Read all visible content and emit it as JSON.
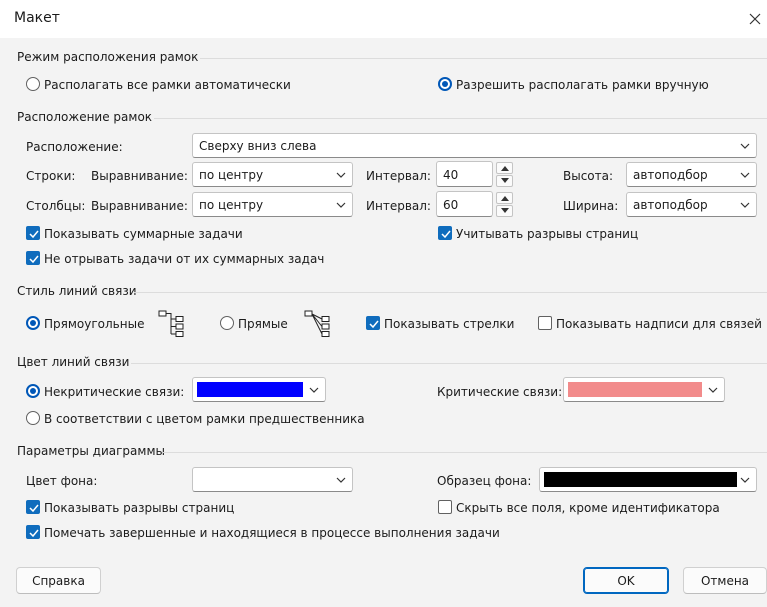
{
  "window": {
    "title": "Макет"
  },
  "colors": {
    "accent": "#0057b7",
    "noncritical": "#0000ff",
    "critical": "#f28b8b",
    "sample": "#000000",
    "background": "#ffffff"
  },
  "frame_mode": {
    "title": "Режим расположения рамок",
    "auto_label": "Располагать все рамки автоматически",
    "manual_label": "Разрешить располагать рамки вручную",
    "selected": "manual"
  },
  "frame_layout": {
    "title": "Расположение рамок",
    "arrangement_label": "Расположение:",
    "arrangement_value": "Сверху вниз слева",
    "rows_label": "Строки:",
    "cols_label": "Столбцы:",
    "align_label": "Выравнивание:",
    "rows_align_value": "по центру",
    "cols_align_value": "по центру",
    "interval_label": "Интервал:",
    "rows_interval": "40",
    "cols_interval": "60",
    "height_label": "Высота:",
    "height_value": "автоподбор",
    "width_label": "Ширина:",
    "width_value": "автоподбор",
    "show_summary_label": "Показывать суммарные задачи",
    "show_summary_checked": true,
    "keep_with_summary_label": "Не отрывать задачи от их суммарных задач",
    "keep_with_summary_checked": true,
    "page_breaks_label": "Учитывать разрывы страниц",
    "page_breaks_checked": true
  },
  "link_style": {
    "title": "Стиль линий связи",
    "rect_label": "Прямоугольные",
    "straight_label": "Прямые",
    "selected": "rect",
    "show_arrows_label": "Показывать стрелки",
    "show_arrows_checked": true,
    "show_labels_label": "Показывать надписи для связей",
    "show_labels_checked": false
  },
  "link_color": {
    "title": "Цвет линий связи",
    "noncritical_label": "Некритические связи:",
    "critical_label": "Критические связи:",
    "match_label": "В соответствии с цветом рамки предшественника",
    "selected": "noncritical"
  },
  "chart_options": {
    "title": "Параметры диаграммы",
    "bg_color_label": "Цвет фона:",
    "bg_pattern_label": "Образец фона:",
    "show_page_breaks_label": "Показывать разрывы страниц",
    "show_page_breaks_checked": true,
    "hide_fields_label": "Скрыть все поля, кроме идентификатора",
    "hide_fields_checked": false,
    "mark_in_progress_label": "Помечать завершенные и находящиеся в процессе выполнения задачи",
    "mark_in_progress_checked": true
  },
  "buttons": {
    "help": "Справка",
    "ok": "OK",
    "cancel": "Отмена"
  }
}
